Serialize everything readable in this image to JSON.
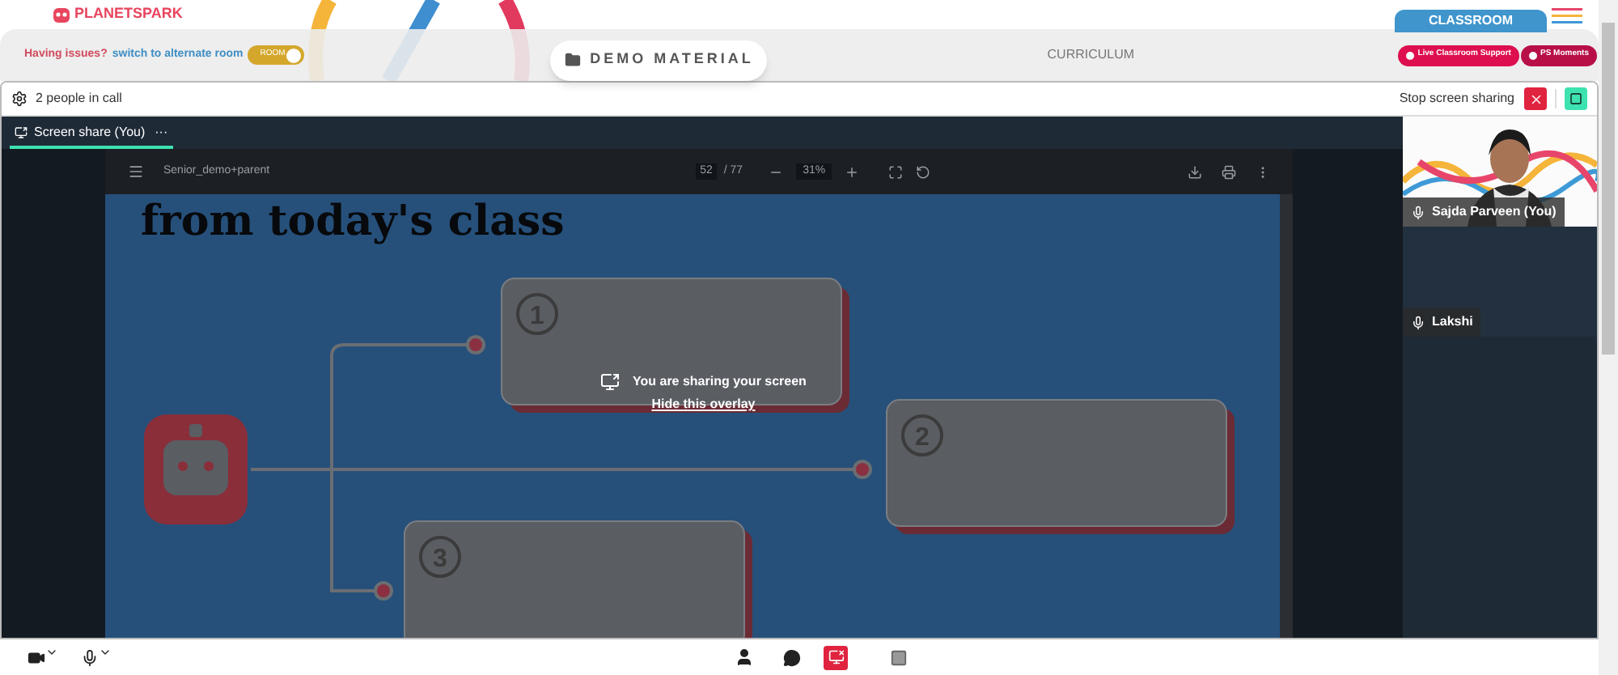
{
  "header": {
    "logo": "PLANETSPARK",
    "classroom_tab": "CLASSROOM"
  },
  "toolbar": {
    "issues_text": "Having issues?",
    "switch_link": "switch to alternate room",
    "room_toggle": {
      "label": "ROOM",
      "on": true
    },
    "demo_button": "DEMO MATERIAL",
    "curriculum": "CURRICULUM",
    "action_buttons": [
      "Live Classroom Support",
      "PS Moments"
    ]
  },
  "call": {
    "people_count": "2 people in call",
    "stop_sharing": "Stop screen sharing",
    "tabs": [
      {
        "label": "Screen share (You)",
        "menu": "···",
        "selected": true
      }
    ],
    "pdf_viewer": {
      "filename": "Senior_demo+parent",
      "page": "52",
      "pages": "/ 77",
      "zoom": "31%"
    },
    "slide": {
      "heading": "from today's class",
      "cards": [
        "1",
        "2",
        "3"
      ]
    },
    "overlay": {
      "message": "You are sharing your screen",
      "link": "Hide this overlay"
    },
    "participants": [
      {
        "name": "Sajda Parveen (You)",
        "video": true
      },
      {
        "name": "Lakshi",
        "video": false
      }
    ]
  },
  "controls": {
    "screen_share_active": true
  }
}
